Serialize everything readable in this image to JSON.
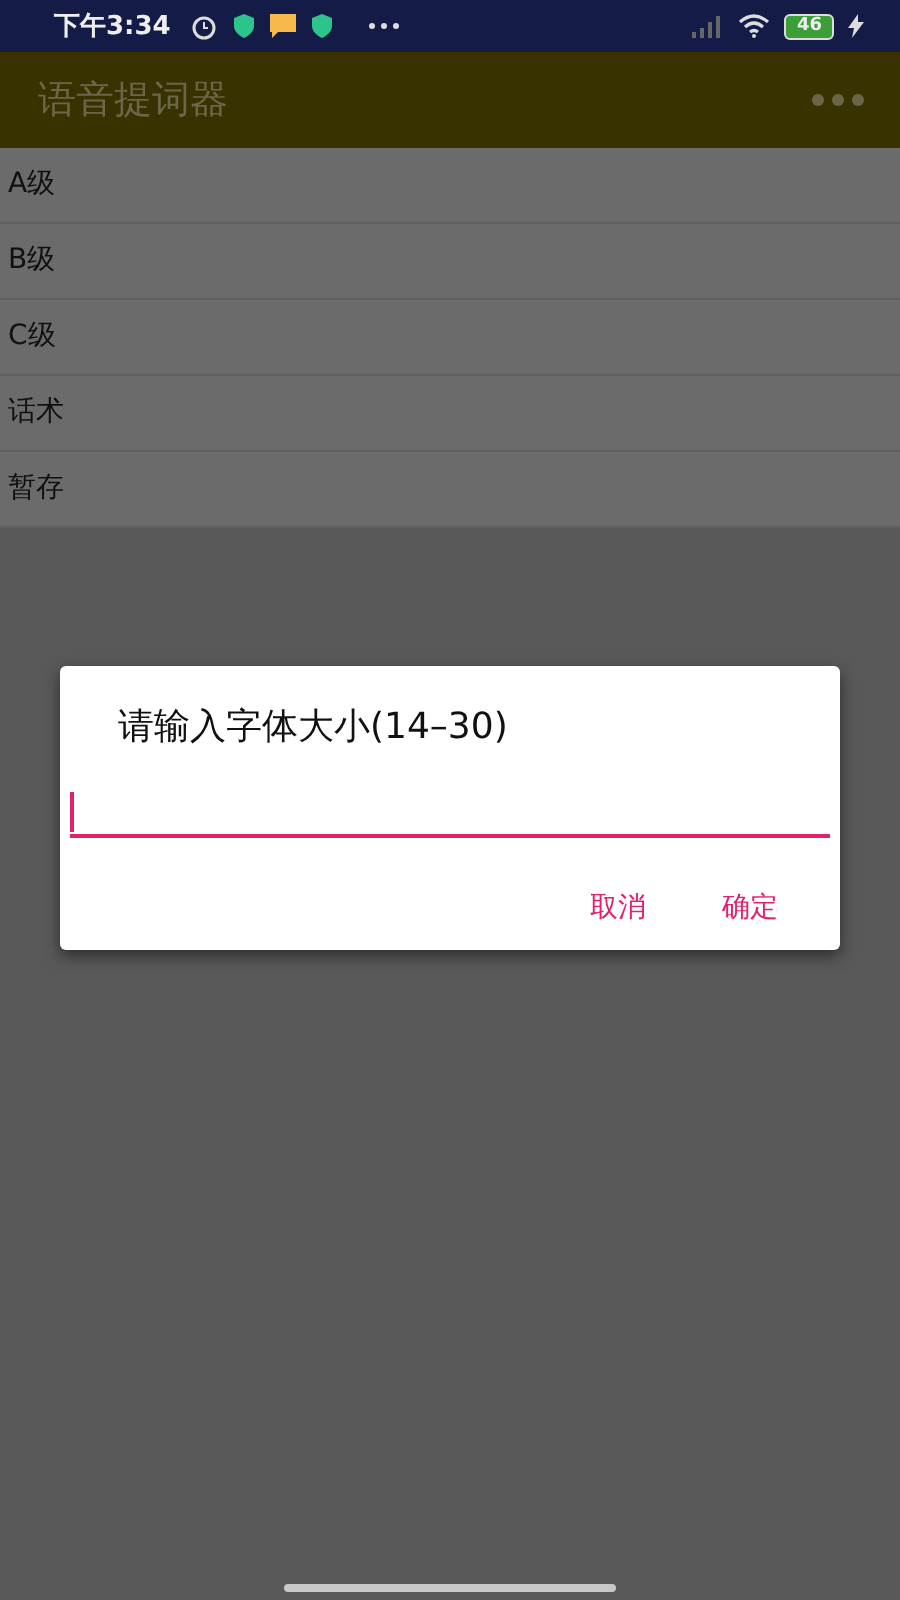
{
  "status_bar": {
    "time": "下午3:34",
    "battery": "46"
  },
  "app_bar": {
    "title": "语音提词器"
  },
  "list": [
    {
      "label": "A级"
    },
    {
      "label": "B级"
    },
    {
      "label": "C级"
    },
    {
      "label": "话术"
    },
    {
      "label": "暂存"
    }
  ],
  "dialog": {
    "title": "请输入字体大小(14–30)",
    "buttons": [
      "取消",
      "确定"
    ]
  }
}
